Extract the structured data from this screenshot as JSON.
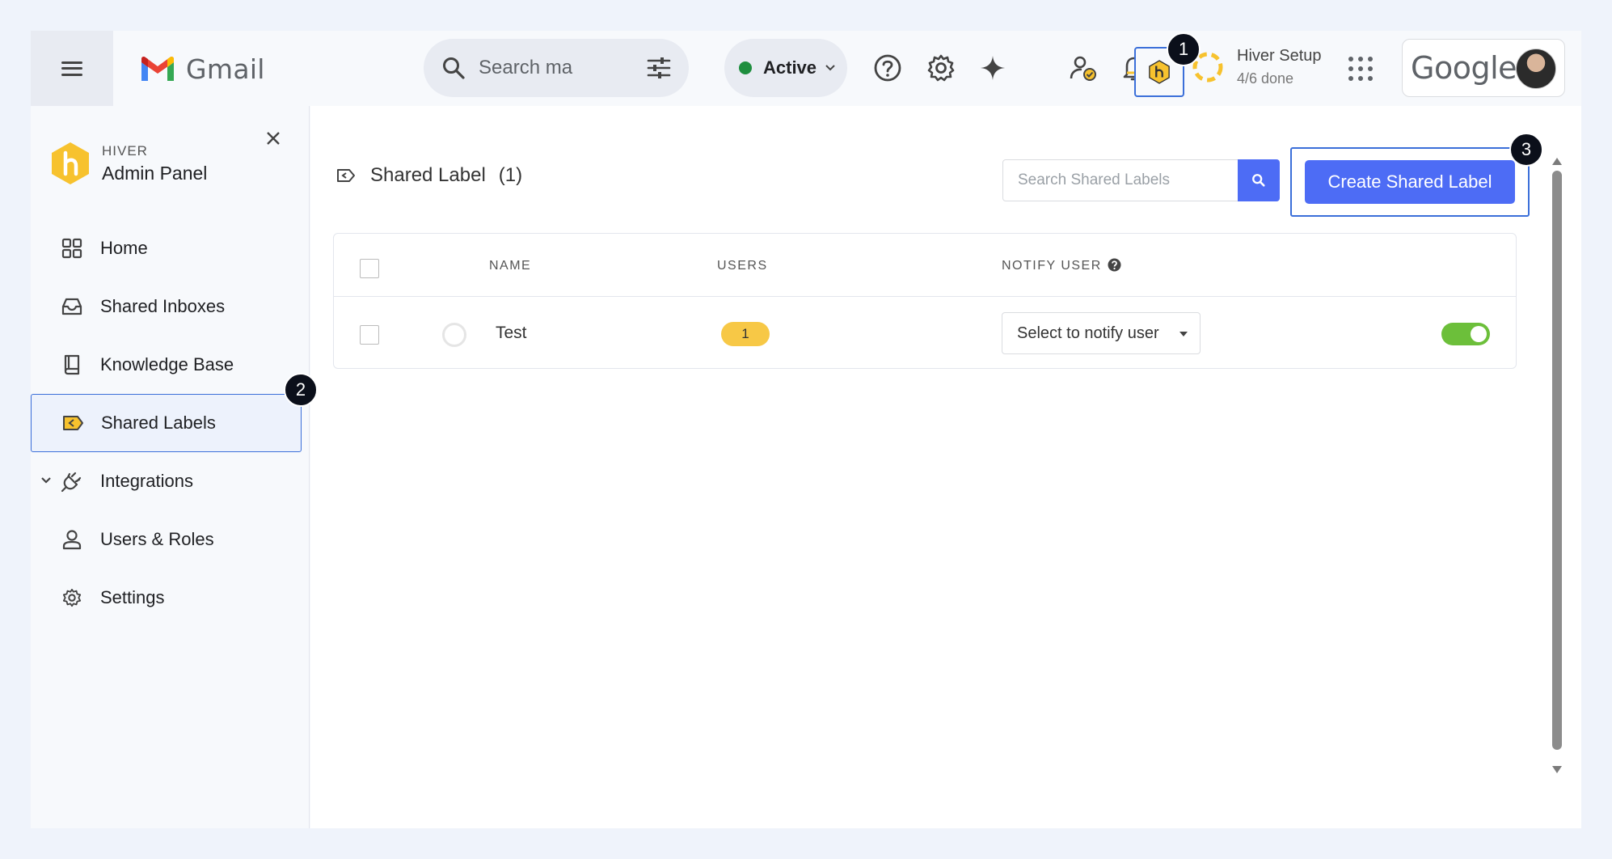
{
  "gmail": {
    "logo_text": "Gmail",
    "search_placeholder": "Search ma",
    "status_label": "Active",
    "status_color": "#1e8e3e",
    "hiver_setup_title": "Hiver Setup",
    "hiver_setup_progress": "4/6 done",
    "google_text": "Google"
  },
  "markers": [
    "1",
    "2",
    "3"
  ],
  "sidebar": {
    "brand_small": "HIVER",
    "brand_title": "Admin Panel",
    "items": [
      {
        "label": "Home",
        "icon": "grid-icon"
      },
      {
        "label": "Shared Inboxes",
        "icon": "inbox-icon"
      },
      {
        "label": "Knowledge Base",
        "icon": "book-icon"
      },
      {
        "label": "Shared Labels",
        "icon": "shared-label-icon",
        "active": true
      },
      {
        "label": "Integrations",
        "icon": "plug-icon"
      },
      {
        "label": "Users & Roles",
        "icon": "user-icon"
      },
      {
        "label": "Settings",
        "icon": "gear-icon"
      }
    ]
  },
  "main": {
    "title": "Shared Label",
    "count": "(1)",
    "search_placeholder": "Search Shared Labels",
    "create_button": "Create Shared Label",
    "columns": [
      "NAME",
      "USERS",
      "NOTIFY USER"
    ],
    "rows": [
      {
        "name": "Test",
        "users": "1",
        "notify": "Select to notify user",
        "enabled": true
      }
    ]
  },
  "colors": {
    "accent": "#4d6cf5",
    "highlight_border": "#3b6fd9",
    "badge": "#f7c846",
    "toggle_on": "#6cbf3a",
    "hiver_yellow": "#f7c22e"
  }
}
